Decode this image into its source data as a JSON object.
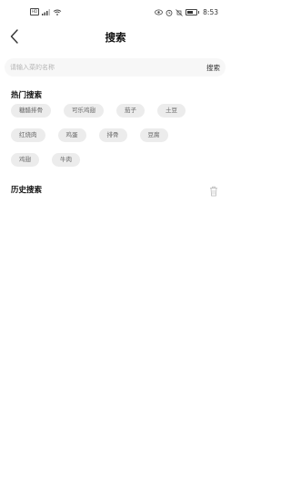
{
  "status_bar": {
    "left_icons": [
      "sim-icon",
      "signal-icon",
      "wifi-icon"
    ],
    "right_icons": [
      "eye-icon",
      "alarm-icon",
      "mute-icon",
      "battery-icon"
    ],
    "time": "8:53"
  },
  "header": {
    "back_icon": "chevron-left-icon",
    "title": "搜索"
  },
  "search": {
    "placeholder": "请输入菜的名称",
    "value": "",
    "button_label": "搜索"
  },
  "hot_search": {
    "title": "热门搜索",
    "rows": [
      [
        "糖醋排骨",
        "可乐鸡翅",
        "茄子",
        "土豆"
      ],
      [
        "红烧肉",
        "鸡蛋",
        "排骨",
        "豆腐"
      ],
      [
        "鸡翅",
        "牛肉"
      ]
    ]
  },
  "history": {
    "title": "历史搜索",
    "clear_icon": "trash-icon",
    "items": []
  },
  "colors": {
    "tag_bg": "#ececec",
    "tag_text": "#666666",
    "search_bg": "#f7f7f7",
    "placeholder": "#b5b5b5"
  }
}
